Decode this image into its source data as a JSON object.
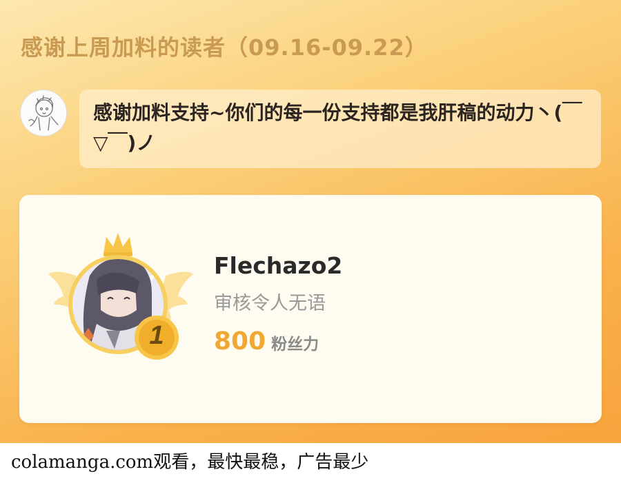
{
  "header": {
    "title": "感谢上周加料的读者（09.16-09.22）"
  },
  "message": {
    "avatar_icon": "sketch-character-avatar",
    "text": "感谢加料支持~你们的每一份支持都是我肝稿的动力丶(￣▽￣)ノ"
  },
  "leaderboard": {
    "entries": [
      {
        "rank": "1",
        "name": "Flechazo2",
        "comment": "审核令人无语",
        "points": "800",
        "points_unit": "粉丝力",
        "avatar_icon": "anime-character-avatar",
        "badge_icon": "crown-wings-icon"
      }
    ],
    "colors": {
      "gold": "#f0a832",
      "badge_wing": "#fbe09a"
    }
  },
  "footer": {
    "text": "colamanga.com观看，最快最稳，广告最少"
  }
}
